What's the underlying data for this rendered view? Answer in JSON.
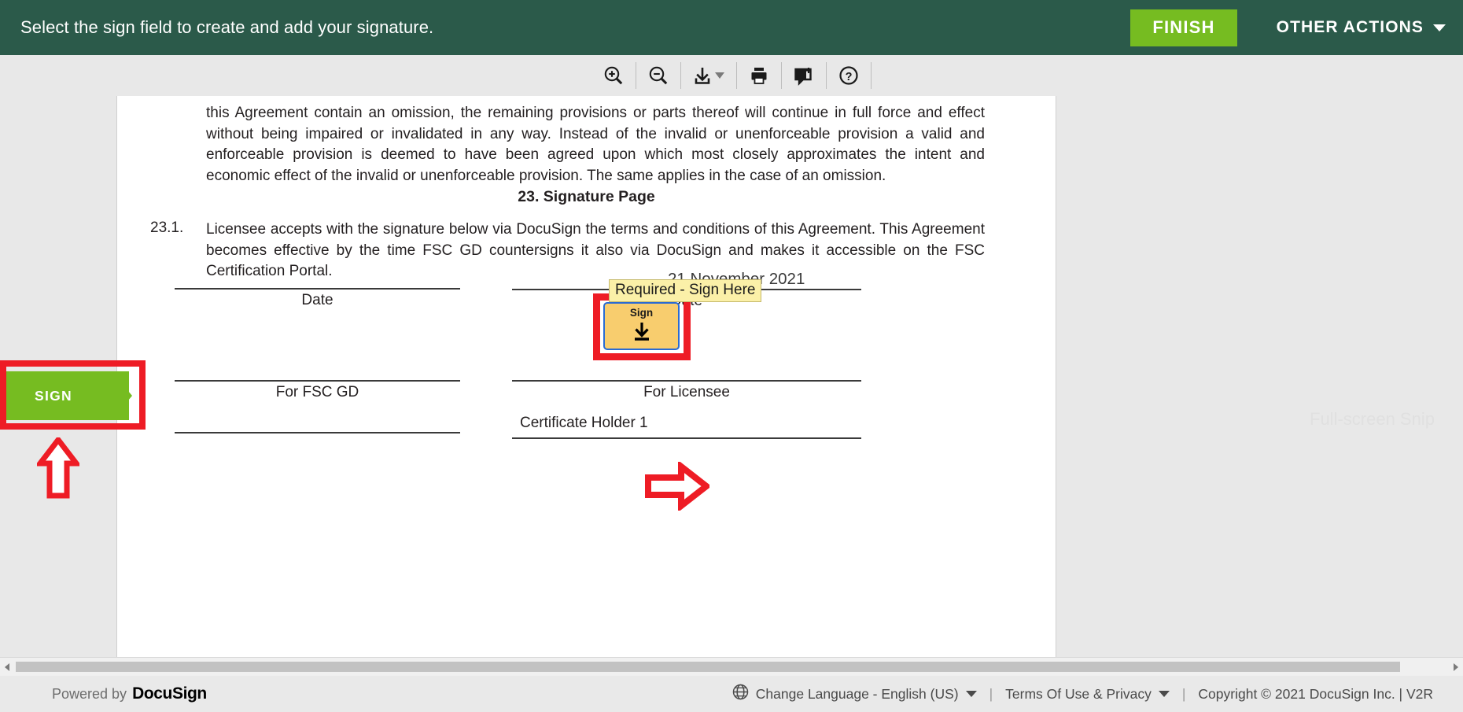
{
  "topbar": {
    "message": "Select the sign field to create and add your signature.",
    "finish_label": "FINISH",
    "other_actions_label": "OTHER ACTIONS",
    "bg_color": "#2b5a4a",
    "finish_color": "#76bc21"
  },
  "toolbar": {
    "items": [
      {
        "name": "zoom-in-icon",
        "tooltip": "Zoom In"
      },
      {
        "name": "zoom-out-icon",
        "tooltip": "Zoom Out"
      },
      {
        "name": "download-icon",
        "tooltip": "Download"
      },
      {
        "name": "print-icon",
        "tooltip": "Print"
      },
      {
        "name": "add-comment-icon",
        "tooltip": "Add Comment"
      },
      {
        "name": "help-icon",
        "tooltip": "Help"
      }
    ]
  },
  "document": {
    "paragraph_top": "this Agreement contain an omission, the remaining provisions or parts thereof will continue in full force and effect without being impaired or invalidated in any way. Instead of the invalid or unenforceable provision a valid and enforceable provision is deemed to have been agreed upon which most closely approximates the intent and economic effect of the invalid or unenforceable provision. The same applies in the case of an omission.",
    "section_heading": "23. Signature Page",
    "clause_number": "23.1.",
    "clause_text": "Licensee accepts with the signature below via DocuSign the terms and conditions of this Agreement. This Agreement becomes effective by the time FSC GD countersigns it also via DocuSign and makes it accessible on the FSC Certification Portal.",
    "left_column": {
      "caption_date": "Date",
      "caption_for": "For FSC GD"
    },
    "right_column": {
      "date_value": "21 November 2021",
      "caption_date": "Date",
      "caption_for": "For Licensee",
      "signer_name": "Certificate Holder 1"
    }
  },
  "sign_field": {
    "label": "Sign",
    "tooltip": "Required - Sign Here",
    "fill_color": "#f8cd6e",
    "border_color": "#2a6bd4",
    "tooltip_color": "#fbf0a8"
  },
  "annotations": {
    "highlight_color": "#ee1c25",
    "sign_tab_label": "SIGN",
    "sign_tab_color": "#76bc21"
  },
  "watermark": {
    "text": "Full-screen Snip"
  },
  "footer": {
    "powered_by": "Powered by",
    "brand": "DocuSign",
    "language_label": "Change Language - English (US)",
    "terms_label": "Terms Of Use & Privacy",
    "copyright": "Copyright © 2021 DocuSign Inc. | V2R",
    "pipe": "|"
  }
}
